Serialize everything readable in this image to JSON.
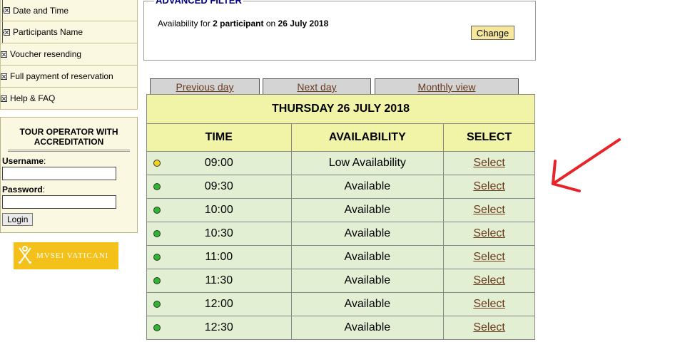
{
  "sidebar": {
    "items": [
      {
        "label": "Date and Time",
        "sub": true
      },
      {
        "label": "Participants Name",
        "sub": true
      },
      {
        "label": "Voucher resending",
        "sub": false
      },
      {
        "label": "Full payment of reservation",
        "sub": false
      },
      {
        "label": "Help & FAQ",
        "sub": false
      }
    ]
  },
  "login": {
    "title": "TOUR OPERATOR WITH ACCREDITATION",
    "username_label": "Username",
    "password_label": "Password",
    "colon": ":",
    "button": "Login"
  },
  "logo": {
    "text": "MVSEI VATICANI"
  },
  "filter": {
    "legend": "ADVANCED FILTER",
    "prefix": "Availability for ",
    "participants": "2 participant",
    "middle": " on ",
    "date": "26 July 2018",
    "change_button": "Change"
  },
  "nav": {
    "previous": "Previous day",
    "next": "Next day",
    "monthly": "Monthly view"
  },
  "table": {
    "date_title": "THURSDAY 26 JULY 2018",
    "headers": {
      "time": "TIME",
      "availability": "AVAILABILITY",
      "select": "SELECT"
    },
    "rows": [
      {
        "time": "09:00",
        "availability": "Low Availability",
        "select": "Select",
        "status_color": "#f2d41e"
      },
      {
        "time": "09:30",
        "availability": "Available",
        "select": "Select",
        "status_color": "#2fb52f"
      },
      {
        "time": "10:00",
        "availability": "Available",
        "select": "Select",
        "status_color": "#2fb52f"
      },
      {
        "time": "10:30",
        "availability": "Available",
        "select": "Select",
        "status_color": "#2fb52f"
      },
      {
        "time": "11:00",
        "availability": "Available",
        "select": "Select",
        "status_color": "#2fb52f"
      },
      {
        "time": "11:30",
        "availability": "Available",
        "select": "Select",
        "status_color": "#2fb52f"
      },
      {
        "time": "12:00",
        "availability": "Available",
        "select": "Select",
        "status_color": "#2fb52f"
      },
      {
        "time": "12:30",
        "availability": "Available",
        "select": "Select",
        "status_color": "#2fb52f"
      }
    ]
  },
  "annotation": {
    "arrow_color": "#e8242b",
    "icon": "red-arrow-icon"
  }
}
